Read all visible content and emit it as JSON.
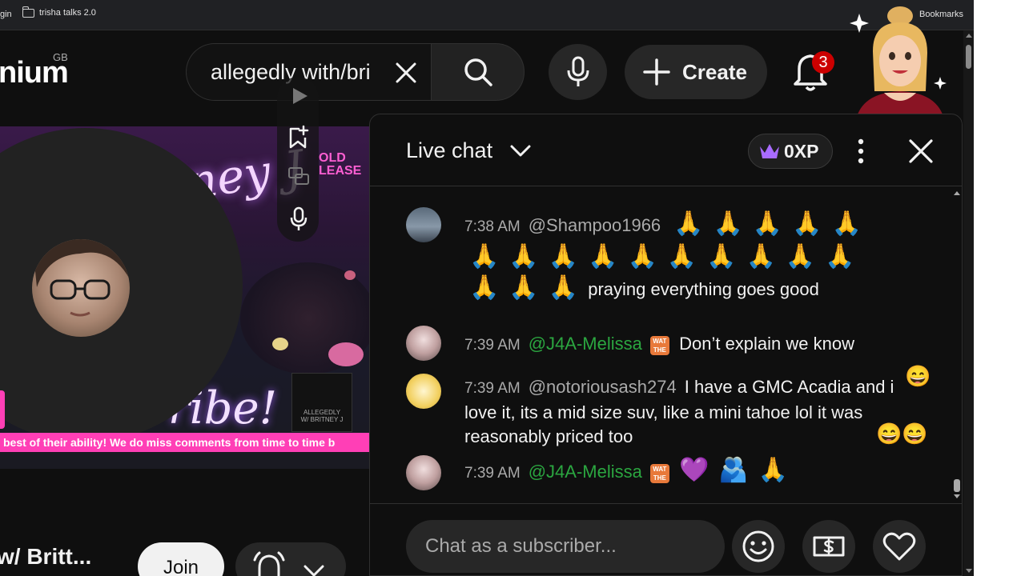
{
  "bookmarks_bar": {
    "left_fragment": "gin",
    "folder_label": "trisha talks 2.0",
    "right_label": "Bookmarks"
  },
  "header": {
    "logo_text": "nium",
    "logo_region": "GB",
    "search_value": "allegedly with/bri",
    "create_label": "Create",
    "notification_count": "3"
  },
  "video": {
    "title_art": "tney J",
    "gold_label_1": "OLD",
    "gold_label_2": "LEASE",
    "subscribe_art": "ribe!",
    "ticker_text": " best of their ability! We do miss comments from time to time b",
    "thumb_text_1": "ALLEGEDLY",
    "thumb_text_2": "W/ BRITNEY J"
  },
  "chat": {
    "title": "Live chat",
    "xp_label": "0XP",
    "input_placeholder": "Chat as a subscriber...",
    "messages": [
      {
        "time": "7:38 AM",
        "author": "@Shampoo1966",
        "text": "praying everything goes good"
      },
      {
        "time": "7:39 AM",
        "author": "@J4A-Melissa",
        "text": "Don’t explain we know"
      },
      {
        "time": "7:39 AM",
        "author": "@notoriousash274",
        "text": "I have a GMC Acadia and i love it, its a mid size suv, like a mini tahoe lol it was reasonably priced too"
      },
      {
        "time": "7:39 AM",
        "author": "@J4A-Melissa",
        "text": ""
      }
    ],
    "badge_text_1": "WAT",
    "badge_text_2": "THE"
  },
  "below_video": {
    "title_fragment": "w/ Britt...",
    "join_label": "Join"
  },
  "colors": {
    "background": "#0f0f0f",
    "member_green": "#2ba640",
    "ticker_pink": "#ff3fb6",
    "badge_red": "#cc0000"
  }
}
